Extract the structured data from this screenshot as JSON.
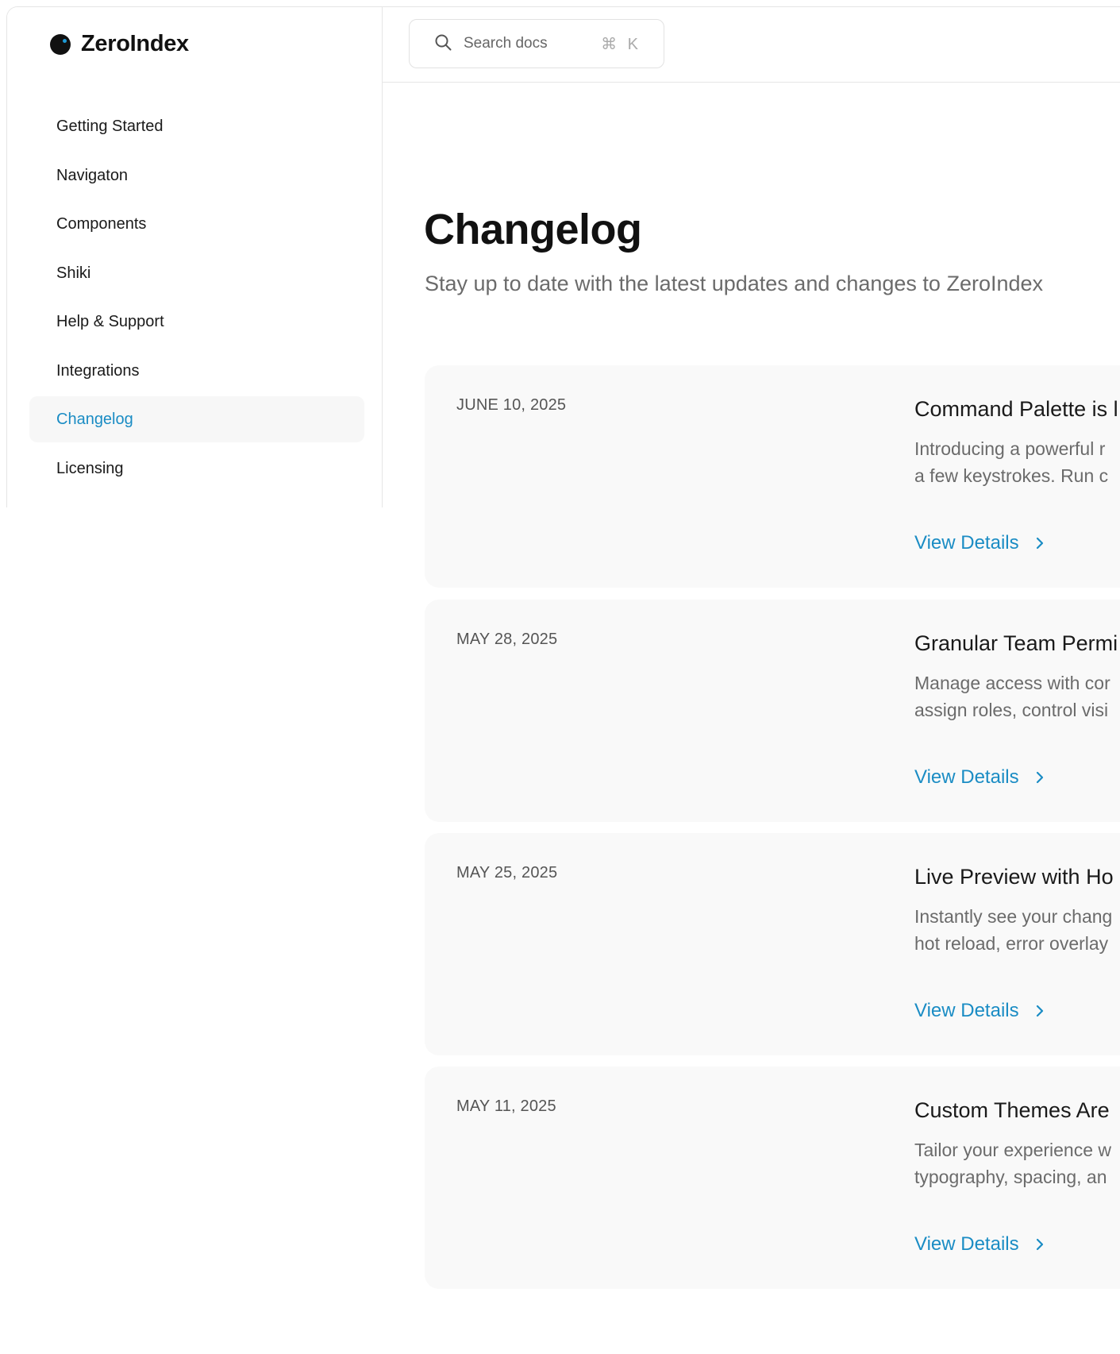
{
  "app": {
    "name": "ZeroIndex"
  },
  "search": {
    "placeholder": "Search docs",
    "shortcut": "⌘ K"
  },
  "sidebar": {
    "items": [
      {
        "label": "Getting Started",
        "active": false
      },
      {
        "label": "Navigaton",
        "active": false
      },
      {
        "label": "Components",
        "active": false
      },
      {
        "label": "Shiki",
        "active": false
      },
      {
        "label": "Help & Support",
        "active": false
      },
      {
        "label": "Integrations",
        "active": false
      },
      {
        "label": "Changelog",
        "active": true
      },
      {
        "label": "Licensing",
        "active": false
      }
    ]
  },
  "page": {
    "title": "Changelog",
    "subtitle": "Stay up to date with the latest updates and changes to ZeroIndex"
  },
  "entries": [
    {
      "date": "JUNE 10, 2025",
      "title": "Command Palette is l",
      "desc_line1": "Introducing a powerful r",
      "desc_line2": "a few keystrokes. Run c",
      "link": "View Details"
    },
    {
      "date": "MAY 28, 2025",
      "title": "Granular Team Permi",
      "desc_line1": "Manage access with cor",
      "desc_line2": "assign roles, control visi",
      "link": "View Details"
    },
    {
      "date": "MAY 25, 2025",
      "title": "Live Preview with Ho",
      "desc_line1": "Instantly see your chang",
      "desc_line2": "hot reload, error overlay",
      "link": "View Details"
    },
    {
      "date": "MAY 11, 2025",
      "title": "Custom Themes Are",
      "desc_line1": "Tailor your experience w",
      "desc_line2": "typography, spacing, an",
      "link": "View Details"
    }
  ],
  "colors": {
    "accent": "#1a8cc4",
    "text": "#1a1a1a",
    "muted": "#6b6b6b",
    "card": "#f9f9f9"
  }
}
